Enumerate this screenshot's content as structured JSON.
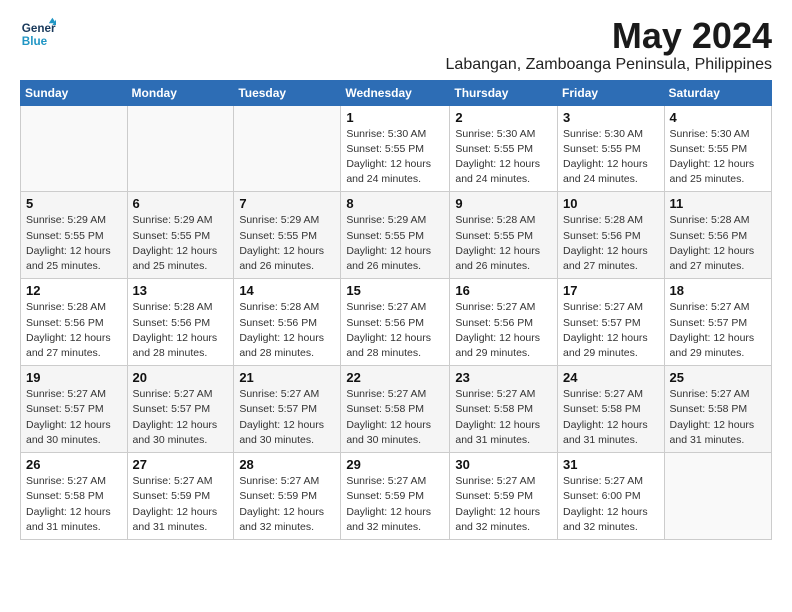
{
  "logo": {
    "line1": "General",
    "line2": "Blue"
  },
  "title": "May 2024",
  "location": "Labangan, Zamboanga Peninsula, Philippines",
  "weekdays": [
    "Sunday",
    "Monday",
    "Tuesday",
    "Wednesday",
    "Thursday",
    "Friday",
    "Saturday"
  ],
  "weeks": [
    [
      {
        "day": "",
        "info": ""
      },
      {
        "day": "",
        "info": ""
      },
      {
        "day": "",
        "info": ""
      },
      {
        "day": "1",
        "info": "Sunrise: 5:30 AM\nSunset: 5:55 PM\nDaylight: 12 hours\nand 24 minutes."
      },
      {
        "day": "2",
        "info": "Sunrise: 5:30 AM\nSunset: 5:55 PM\nDaylight: 12 hours\nand 24 minutes."
      },
      {
        "day": "3",
        "info": "Sunrise: 5:30 AM\nSunset: 5:55 PM\nDaylight: 12 hours\nand 24 minutes."
      },
      {
        "day": "4",
        "info": "Sunrise: 5:30 AM\nSunset: 5:55 PM\nDaylight: 12 hours\nand 25 minutes."
      }
    ],
    [
      {
        "day": "5",
        "info": "Sunrise: 5:29 AM\nSunset: 5:55 PM\nDaylight: 12 hours\nand 25 minutes."
      },
      {
        "day": "6",
        "info": "Sunrise: 5:29 AM\nSunset: 5:55 PM\nDaylight: 12 hours\nand 25 minutes."
      },
      {
        "day": "7",
        "info": "Sunrise: 5:29 AM\nSunset: 5:55 PM\nDaylight: 12 hours\nand 26 minutes."
      },
      {
        "day": "8",
        "info": "Sunrise: 5:29 AM\nSunset: 5:55 PM\nDaylight: 12 hours\nand 26 minutes."
      },
      {
        "day": "9",
        "info": "Sunrise: 5:28 AM\nSunset: 5:55 PM\nDaylight: 12 hours\nand 26 minutes."
      },
      {
        "day": "10",
        "info": "Sunrise: 5:28 AM\nSunset: 5:56 PM\nDaylight: 12 hours\nand 27 minutes."
      },
      {
        "day": "11",
        "info": "Sunrise: 5:28 AM\nSunset: 5:56 PM\nDaylight: 12 hours\nand 27 minutes."
      }
    ],
    [
      {
        "day": "12",
        "info": "Sunrise: 5:28 AM\nSunset: 5:56 PM\nDaylight: 12 hours\nand 27 minutes."
      },
      {
        "day": "13",
        "info": "Sunrise: 5:28 AM\nSunset: 5:56 PM\nDaylight: 12 hours\nand 28 minutes."
      },
      {
        "day": "14",
        "info": "Sunrise: 5:28 AM\nSunset: 5:56 PM\nDaylight: 12 hours\nand 28 minutes."
      },
      {
        "day": "15",
        "info": "Sunrise: 5:27 AM\nSunset: 5:56 PM\nDaylight: 12 hours\nand 28 minutes."
      },
      {
        "day": "16",
        "info": "Sunrise: 5:27 AM\nSunset: 5:56 PM\nDaylight: 12 hours\nand 29 minutes."
      },
      {
        "day": "17",
        "info": "Sunrise: 5:27 AM\nSunset: 5:57 PM\nDaylight: 12 hours\nand 29 minutes."
      },
      {
        "day": "18",
        "info": "Sunrise: 5:27 AM\nSunset: 5:57 PM\nDaylight: 12 hours\nand 29 minutes."
      }
    ],
    [
      {
        "day": "19",
        "info": "Sunrise: 5:27 AM\nSunset: 5:57 PM\nDaylight: 12 hours\nand 30 minutes."
      },
      {
        "day": "20",
        "info": "Sunrise: 5:27 AM\nSunset: 5:57 PM\nDaylight: 12 hours\nand 30 minutes."
      },
      {
        "day": "21",
        "info": "Sunrise: 5:27 AM\nSunset: 5:57 PM\nDaylight: 12 hours\nand 30 minutes."
      },
      {
        "day": "22",
        "info": "Sunrise: 5:27 AM\nSunset: 5:58 PM\nDaylight: 12 hours\nand 30 minutes."
      },
      {
        "day": "23",
        "info": "Sunrise: 5:27 AM\nSunset: 5:58 PM\nDaylight: 12 hours\nand 31 minutes."
      },
      {
        "day": "24",
        "info": "Sunrise: 5:27 AM\nSunset: 5:58 PM\nDaylight: 12 hours\nand 31 minutes."
      },
      {
        "day": "25",
        "info": "Sunrise: 5:27 AM\nSunset: 5:58 PM\nDaylight: 12 hours\nand 31 minutes."
      }
    ],
    [
      {
        "day": "26",
        "info": "Sunrise: 5:27 AM\nSunset: 5:58 PM\nDaylight: 12 hours\nand 31 minutes."
      },
      {
        "day": "27",
        "info": "Sunrise: 5:27 AM\nSunset: 5:59 PM\nDaylight: 12 hours\nand 31 minutes."
      },
      {
        "day": "28",
        "info": "Sunrise: 5:27 AM\nSunset: 5:59 PM\nDaylight: 12 hours\nand 32 minutes."
      },
      {
        "day": "29",
        "info": "Sunrise: 5:27 AM\nSunset: 5:59 PM\nDaylight: 12 hours\nand 32 minutes."
      },
      {
        "day": "30",
        "info": "Sunrise: 5:27 AM\nSunset: 5:59 PM\nDaylight: 12 hours\nand 32 minutes."
      },
      {
        "day": "31",
        "info": "Sunrise: 5:27 AM\nSunset: 6:00 PM\nDaylight: 12 hours\nand 32 minutes."
      },
      {
        "day": "",
        "info": ""
      }
    ]
  ]
}
